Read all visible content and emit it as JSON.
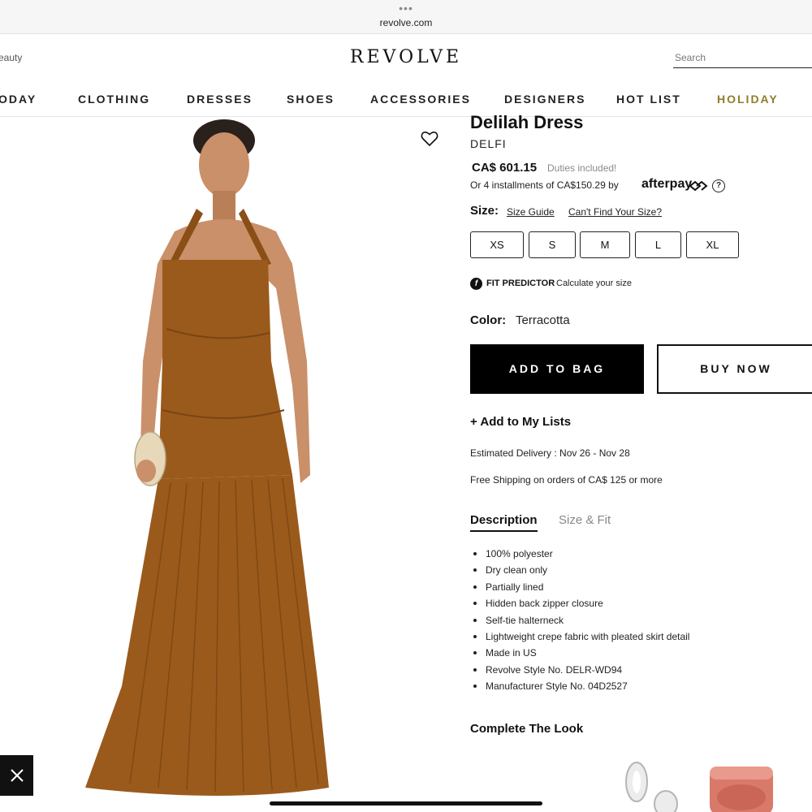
{
  "browser": {
    "dots": "•••",
    "url": "revolve.com"
  },
  "header": {
    "utility_link": "eauty",
    "logo": "REVOLVE",
    "search_placeholder": "Search"
  },
  "nav": {
    "items": [
      "ODAY",
      "CLOTHING",
      "DRESSES",
      "SHOES",
      "ACCESSORIES",
      "DESIGNERS",
      "HOT LIST",
      "HOLIDAY"
    ]
  },
  "product": {
    "title": "Delilah Dress",
    "brand": "DELFI",
    "price": "CA$ 601.15",
    "duties": "Duties included!",
    "installments": "Or 4 installments of CA$150.29 by",
    "afterpay": "afterpay",
    "help": "?",
    "size_label": "Size:",
    "size_guide": "Size Guide",
    "cant_find_size": "Can't Find Your Size?",
    "sizes": [
      "XS",
      "S",
      "M",
      "L",
      "XL"
    ],
    "fit_icon": "f",
    "fit_predictor": "FIT PREDICTOR",
    "fit_calc": "Calculate your size",
    "color_label": "Color:",
    "color_value": "Terracotta",
    "add_to_bag": "ADD TO BAG",
    "buy_now": "BUY NOW",
    "add_lists": "+ Add to My Lists",
    "delivery": "Estimated Delivery : Nov 26 - Nov 28",
    "shipping": "Free Shipping on orders of CA$ 125 or more",
    "tabs": [
      "Description",
      "Size & Fit"
    ],
    "description": [
      "100% polyester",
      "Dry clean only",
      "Partially lined",
      "Hidden back zipper closure",
      "Self-tie halterneck",
      "Lightweight crepe fabric with pleated skirt detail",
      "Made in US",
      "Revolve Style No. DELR-WD94",
      "Manufacturer Style No. 04D2527"
    ],
    "complete_look": "Complete The Look"
  },
  "colors": {
    "dress": "#9a5a1c",
    "dress_shadow": "#7a4512",
    "skin": "#c9906a",
    "holiday": "#8f7e2a",
    "blush": "#d9796a"
  },
  "icons": {
    "heart": "heart-icon",
    "close": "close-icon",
    "help": "question-circle-icon",
    "fit": "fit-predictor-icon",
    "afterpay": "afterpay-logo-icon"
  }
}
